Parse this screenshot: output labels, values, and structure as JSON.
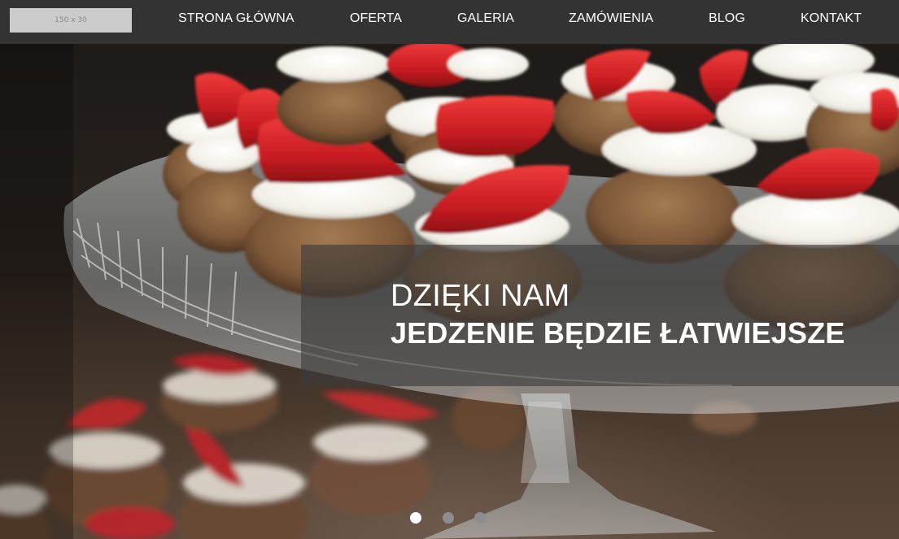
{
  "header": {
    "logo_placeholder": "150 x 30",
    "nav": [
      {
        "label": "STRONA GŁÓWNA"
      },
      {
        "label": "OFERTA"
      },
      {
        "label": "GALERIA"
      },
      {
        "label": "ZAMÓWIENIA"
      },
      {
        "label": "BLOG"
      },
      {
        "label": "KONTAKT"
      }
    ]
  },
  "hero": {
    "line1": "DZIĘKI NAM",
    "line2": "JEDZENIE BĘDZIE ŁATWIEJSZE",
    "image_subject": "strawberry cream cupcakes on a crystal cake stand",
    "slider": {
      "slide_count": 3,
      "active_slide": 1
    }
  },
  "colors": {
    "header_bg": "#333333",
    "logo_bg": "#cccccc",
    "overlay": "rgba(60,60,60,0.62)",
    "dot_active": "#ffffff",
    "dot_inactive": "#8d8d8d"
  }
}
